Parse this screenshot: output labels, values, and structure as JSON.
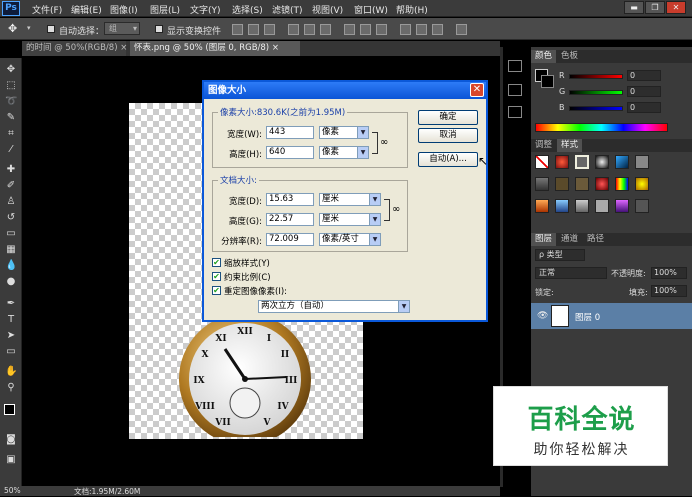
{
  "app": {
    "logo": "Ps"
  },
  "menu": [
    "文件(F)",
    "编辑(E)",
    "图像(I)",
    "图层(L)",
    "文字(Y)",
    "选择(S)",
    "滤镜(T)",
    "视图(V)",
    "窗口(W)",
    "帮助(H)"
  ],
  "window_controls": {
    "minimize": "▬",
    "restore": "❐",
    "close": "✕"
  },
  "options": {
    "auto_select": "自动选择：",
    "auto_select_value": "组",
    "show_transform": "显示变换控件"
  },
  "doc_tabs": [
    {
      "label": "的时间 @ 50%(RGB/8)",
      "close": "×"
    },
    {
      "label": "怀表.png @ 50% (图层 0, RGB/8)",
      "close": "×"
    }
  ],
  "dialog": {
    "title": "图像大小",
    "close": "✕",
    "pixel_dim_title": "像素大小:830.6K(之前为1.95M)",
    "width_label": "宽度(W):",
    "width_value": "443",
    "width_unit": "像素",
    "height_label": "高度(H):",
    "height_value": "640",
    "height_unit": "像素",
    "doc_size_title": "文档大小:",
    "doc_width_label": "宽度(D):",
    "doc_width_value": "15.63",
    "doc_width_unit": "厘米",
    "doc_height_label": "高度(G):",
    "doc_height_value": "22.57",
    "doc_height_unit": "厘米",
    "resolution_label": "分辨率(R):",
    "resolution_value": "72.009",
    "resolution_unit": "像素/英寸",
    "scale_styles": "缩放样式(Y)",
    "constrain": "约束比例(C)",
    "resample": "重定图像像素(I):",
    "resample_method": "两次立方（自动）",
    "ok": "确定",
    "cancel": "取消",
    "auto": "自动(A)..."
  },
  "color_panel": {
    "tabs": [
      "颜色",
      "色板"
    ],
    "channels": [
      "R",
      "G",
      "B"
    ],
    "values": [
      "0",
      "0",
      "0"
    ]
  },
  "style_panel": {
    "tabs": [
      "调整",
      "样式"
    ]
  },
  "layers_panel": {
    "tabs": [
      "图层",
      "通道",
      "路径"
    ],
    "filter": "ρ 类型",
    "blend_mode": "正常",
    "opacity_label": "不透明度:",
    "opacity_value": "100%",
    "lock_label": "锁定:",
    "fill_label": "填充:",
    "fill_value": "100%",
    "layer_name": "图层 0"
  },
  "status": {
    "zoom": "50%",
    "doc": "文档:1.95M/2.60M"
  },
  "watermark": {
    "title": "百科全说",
    "subtitle": "助你轻松解决"
  }
}
